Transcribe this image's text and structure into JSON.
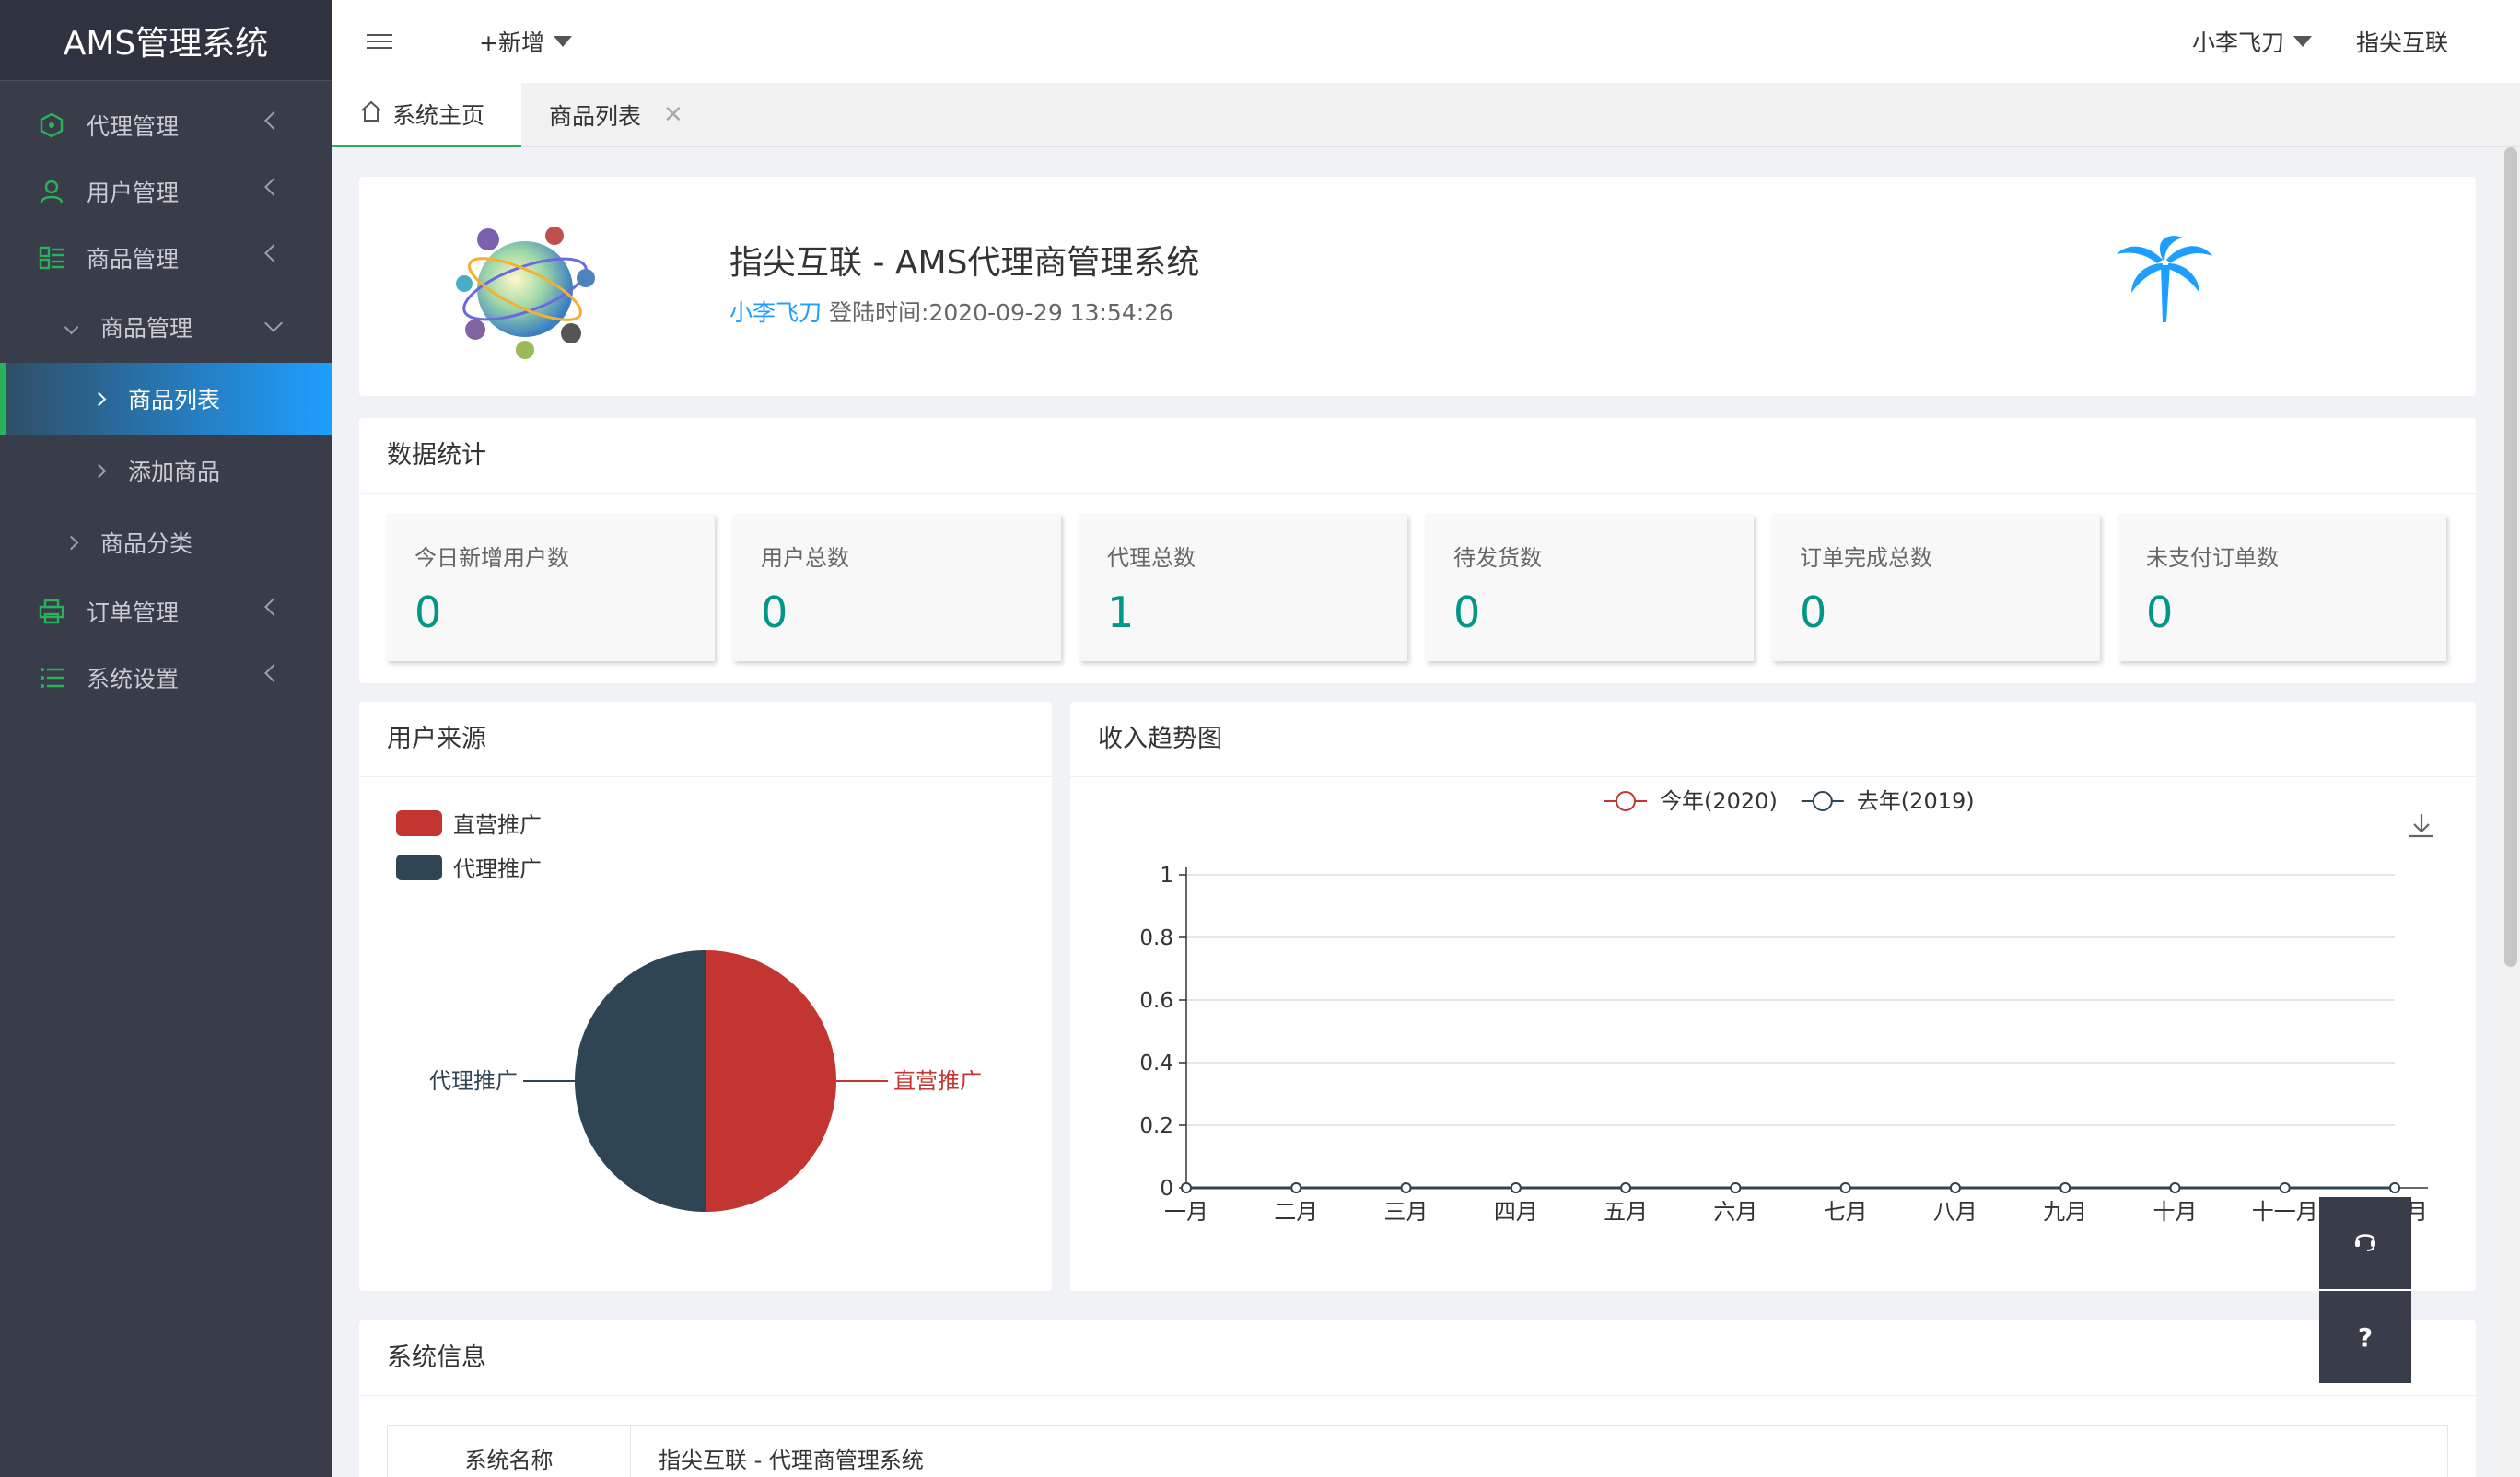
{
  "sidebar": {
    "brand": "AMS管理系统",
    "items": [
      {
        "label": "代理管理",
        "icon": "agent-icon"
      },
      {
        "label": "用户管理",
        "icon": "user-icon"
      },
      {
        "label": "商品管理",
        "icon": "goods-icon"
      },
      {
        "label": "订单管理",
        "icon": "printer-icon"
      },
      {
        "label": "系统设置",
        "icon": "list-settings-icon"
      }
    ],
    "goods_sub": {
      "group_label": "商品管理",
      "items": [
        "商品列表",
        "添加商品"
      ],
      "category_label": "商品分类"
    }
  },
  "header": {
    "add_label": "+新增",
    "user_name": "小李飞刀",
    "brand_link": "指尖互联"
  },
  "tabs": [
    {
      "label": "系统主页"
    },
    {
      "label": "商品列表"
    }
  ],
  "welcome": {
    "title": "指尖互联 - AMS代理商管理系统",
    "user": "小李飞刀",
    "login_time": "登陆时间:2020-09-29 13:54:26"
  },
  "stats": {
    "title": "数据统计",
    "items": [
      {
        "label": "今日新增用户数",
        "value": "0"
      },
      {
        "label": "用户总数",
        "value": "0"
      },
      {
        "label": "代理总数",
        "value": "1"
      },
      {
        "label": "待发货数",
        "value": "0"
      },
      {
        "label": "订单完成总数",
        "value": "0"
      },
      {
        "label": "未支付订单数",
        "value": "0"
      }
    ]
  },
  "source": {
    "title": "用户来源"
  },
  "trend": {
    "title": "收入趋势图"
  },
  "sysinfo": {
    "title": "系统信息",
    "rows": [
      {
        "key": "系统名称",
        "value": "指尖互联 - 代理商管理系统"
      }
    ]
  },
  "float_buttons": {
    "help": "?"
  },
  "colors": {
    "accent_green": "#29b25c",
    "value_teal": "#009688",
    "link_blue": "#1e9fff",
    "pie_red": "#c23531",
    "pie_navy": "#2f4554"
  },
  "chart_data": [
    {
      "type": "pie",
      "title": "",
      "legend": [
        "直营推广",
        "代理推广"
      ],
      "legend_position": "top-left",
      "slices": [
        {
          "name": "直营推广",
          "value": 50,
          "color": "#c23531"
        },
        {
          "name": "代理推广",
          "value": 50,
          "color": "#2f4554"
        }
      ]
    },
    {
      "type": "line",
      "title": "",
      "legend_position": "top-center",
      "categories": [
        "一月",
        "二月",
        "三月",
        "四月",
        "五月",
        "六月",
        "七月",
        "八月",
        "九月",
        "十月",
        "十一月",
        "十二月"
      ],
      "series": [
        {
          "name": "今年(2020)",
          "color": "#c23531",
          "values": [
            0,
            0,
            0,
            0,
            0,
            0,
            0,
            0,
            0,
            0,
            0,
            0
          ]
        },
        {
          "name": "去年(2019)",
          "color": "#2f4554",
          "values": [
            0,
            0,
            0,
            0,
            0,
            0,
            0,
            0,
            0,
            0,
            0,
            0
          ]
        }
      ],
      "yticks": [
        "0",
        "0.2",
        "0.4",
        "0.6",
        "0.8",
        "1"
      ],
      "ylim": [
        0,
        1
      ],
      "grid": true
    }
  ]
}
